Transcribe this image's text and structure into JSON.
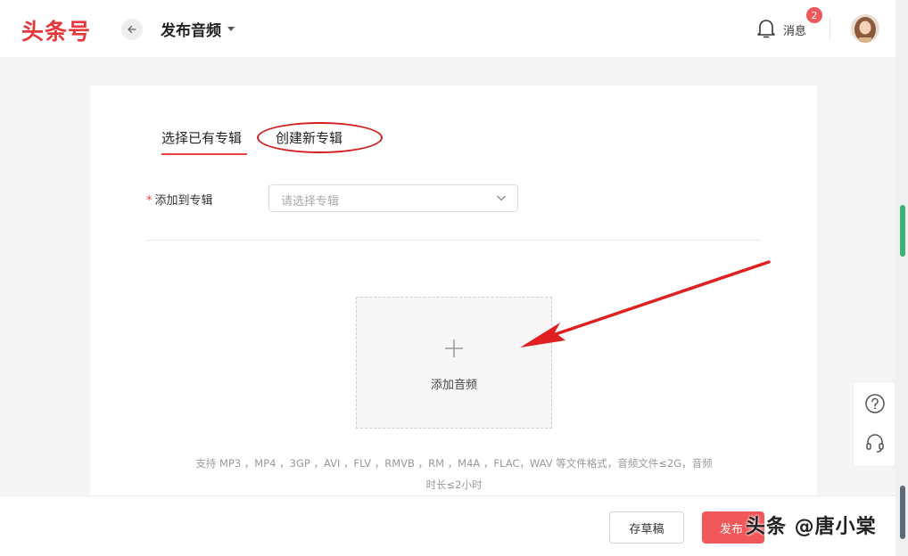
{
  "header": {
    "logo": "头条号",
    "page_title": "发布音频",
    "notification_count": "2",
    "notification_label": "消息"
  },
  "tabs": [
    {
      "label": "选择已有专辑",
      "active": true
    },
    {
      "label": "创建新专辑",
      "active": false
    }
  ],
  "form": {
    "album_label": "添加到专辑",
    "required_mark": "*",
    "album_placeholder": "请选择专辑"
  },
  "upload": {
    "label": "添加音频",
    "hint_line1": "支持 MP3 ，MP4 ，3GP ，AVI ，FLV ，RMVB ，RM ，M4A ，FLAC，WAV 等文件格式，音频文件≤2G，音频",
    "hint_line2": "时长≤2小时"
  },
  "footer": {
    "draft_label": "存草稿",
    "publish_label": "发布"
  },
  "watermark": "头条 @唐小棠",
  "colors": {
    "brand_red": "#e8373a",
    "publish_bg": "#f0575a",
    "annotation_red": "#d11e1e"
  }
}
